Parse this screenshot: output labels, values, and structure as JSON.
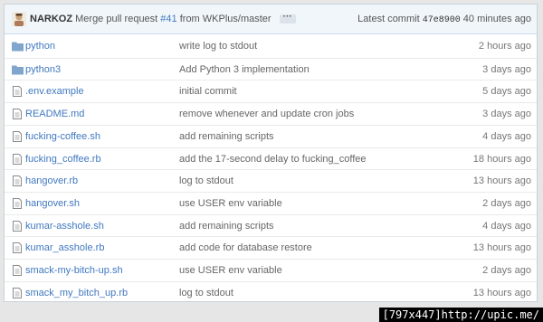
{
  "commit": {
    "author": "NARKOZ",
    "message_prefix": "Merge pull request",
    "pr_number": "#41",
    "message_suffix": "from WKPlus/master",
    "ellipsis": "···",
    "latest_label": "Latest commit",
    "sha": "47e8900",
    "age": "40 minutes ago"
  },
  "files": [
    {
      "type": "folder",
      "name": "python",
      "message": "write log to stdout",
      "age": "2 hours ago"
    },
    {
      "type": "folder",
      "name": "python3",
      "message": "Add Python 3 implementation",
      "age": "3 days ago"
    },
    {
      "type": "file",
      "name": ".env.example",
      "message": "initial commit",
      "age": "5 days ago"
    },
    {
      "type": "file",
      "name": "README.md",
      "message": "remove whenever and update cron jobs",
      "age": "3 days ago"
    },
    {
      "type": "file",
      "name": "fucking-coffee.sh",
      "message": "add remaining scripts",
      "age": "4 days ago"
    },
    {
      "type": "file",
      "name": "fucking_coffee.rb",
      "message": "add the 17-second delay to fucking_coffee",
      "age": "18 hours ago"
    },
    {
      "type": "file",
      "name": "hangover.rb",
      "message": "log to stdout",
      "age": "13 hours ago"
    },
    {
      "type": "file",
      "name": "hangover.sh",
      "message": "use USER env variable",
      "age": "2 days ago"
    },
    {
      "type": "file",
      "name": "kumar-asshole.sh",
      "message": "add remaining scripts",
      "age": "4 days ago"
    },
    {
      "type": "file",
      "name": "kumar_asshole.rb",
      "message": "add code for database restore",
      "age": "13 hours ago"
    },
    {
      "type": "file",
      "name": "smack-my-bitch-up.sh",
      "message": "use USER env variable",
      "age": "2 days ago"
    },
    {
      "type": "file",
      "name": "smack_my_bitch_up.rb",
      "message": "log to stdout",
      "age": "13 hours ago"
    }
  ],
  "footer": {
    "text": "[797x447]http://upic.me/"
  }
}
